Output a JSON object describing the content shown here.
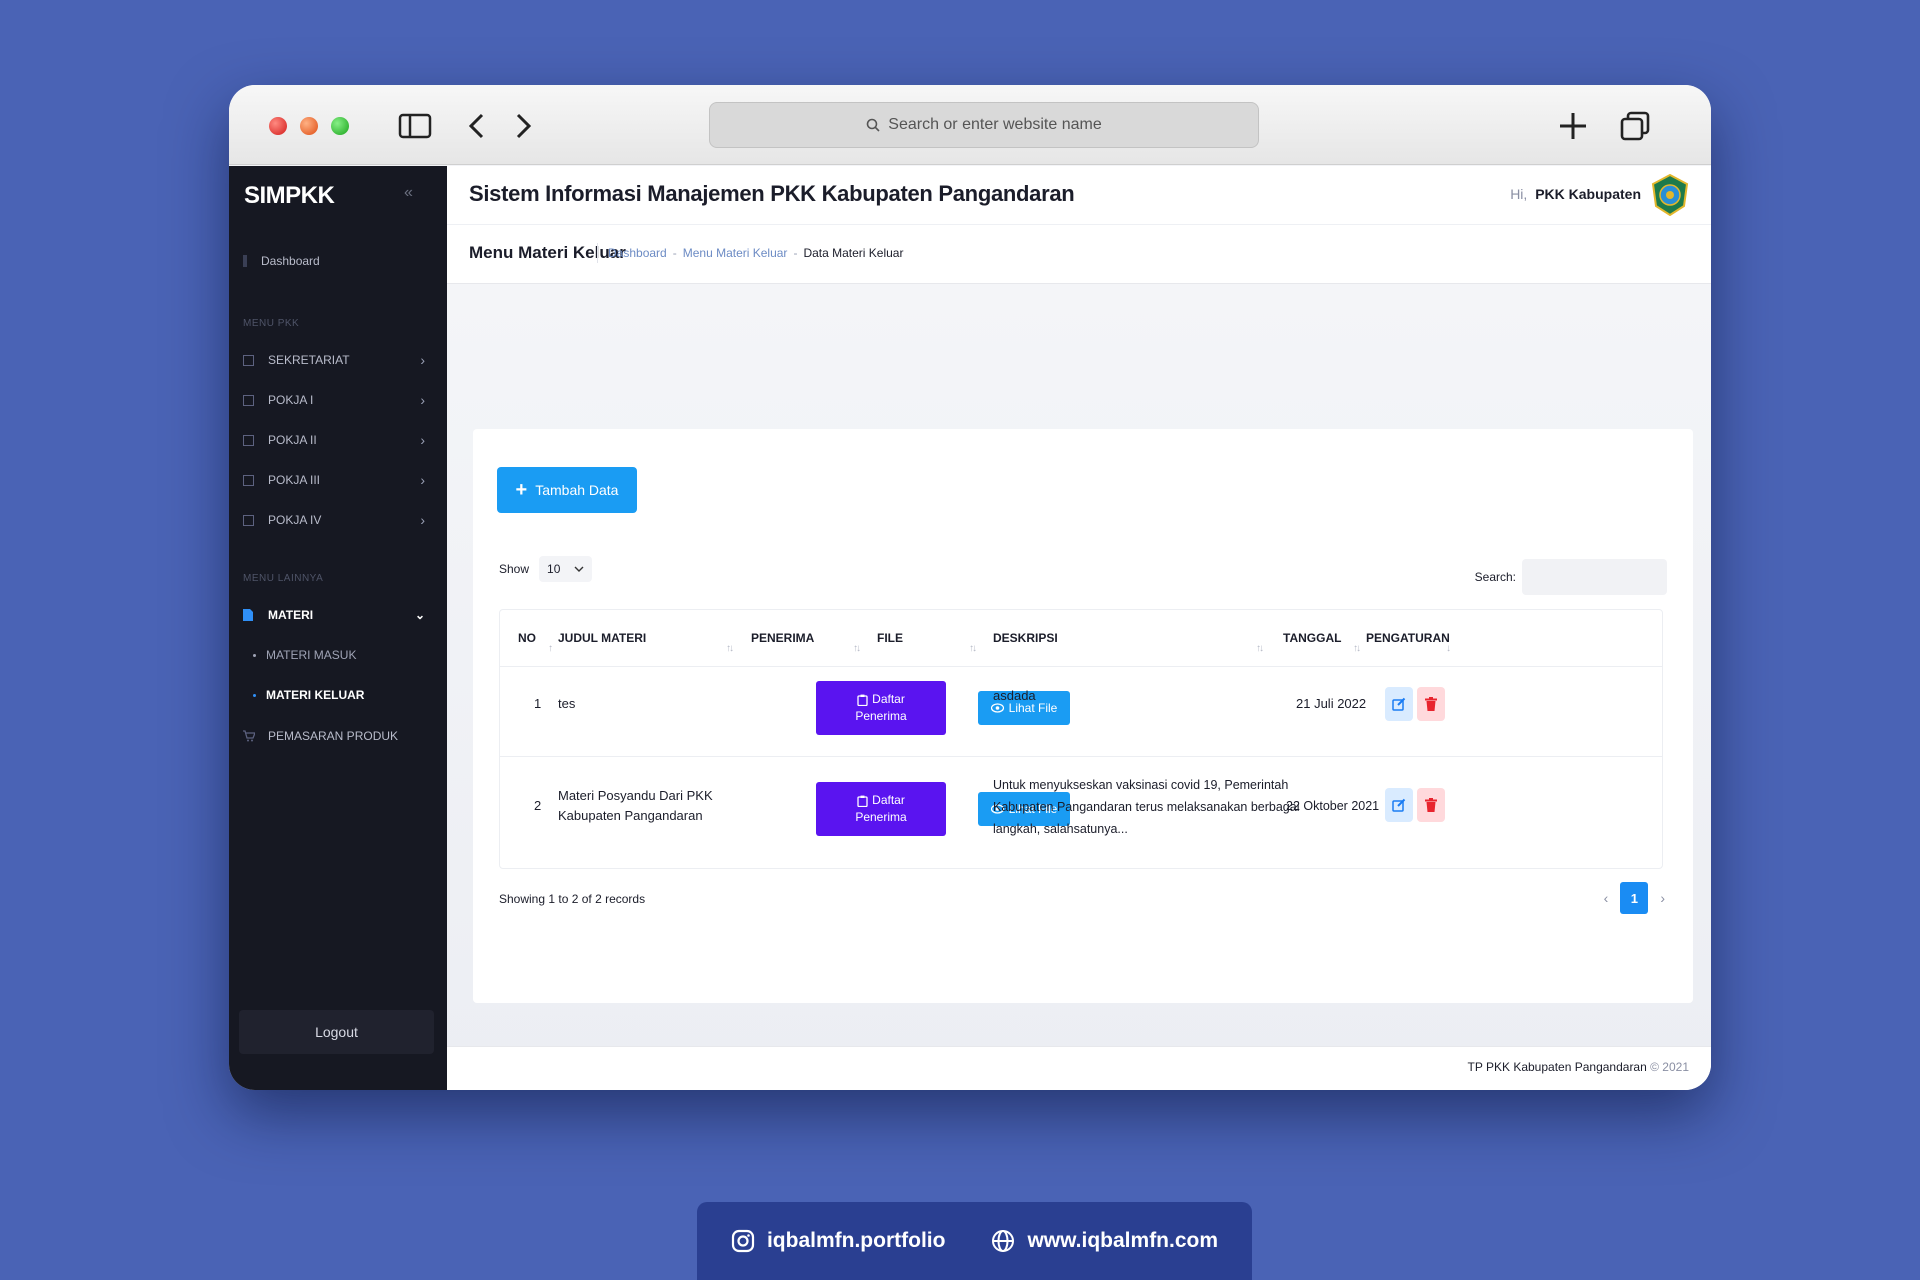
{
  "browser": {
    "url_placeholder": "Search or enter website name"
  },
  "sidebar": {
    "brand": "SIMPKK",
    "dashboard": "Dashboard",
    "menu_pkk_heading": "MENU PKK",
    "menu_pkk": [
      {
        "label": "SEKRETARIAT"
      },
      {
        "label": "POKJA I"
      },
      {
        "label": "POKJA II"
      },
      {
        "label": "POKJA III"
      },
      {
        "label": "POKJA IV"
      }
    ],
    "menu_lainnya_heading": "MENU LAINNYA",
    "materi": "MATERI",
    "materi_sub": [
      {
        "label": "MATERI MASUK"
      },
      {
        "label": "MATERI KELUAR"
      }
    ],
    "pemasaran": "PEMASARAN PRODUK",
    "logout": "Logout"
  },
  "header": {
    "app_title": "Sistem Informasi Manajemen PKK Kabupaten Pangandaran",
    "greeting_hi": "Hi,",
    "greeting_name": "PKK Kabupaten",
    "page_title": "Menu Materi Keluar",
    "breadcrumb": [
      "Dashboard",
      "Menu Materi Keluar",
      "Data Materi Keluar"
    ],
    "breadcrumb_sep": "-"
  },
  "content": {
    "add_button": "Tambah Data",
    "show_label": "Show",
    "show_value": "10",
    "search_label": "Search:",
    "columns": [
      "NO",
      "JUDUL MATERI",
      "PENERIMA",
      "FILE",
      "DESKRIPSI",
      "TANGGAL",
      "PENGATURAN"
    ],
    "rows": [
      {
        "no": "1",
        "judul": "tes",
        "penerima_btn_line1": "Daftar",
        "penerima_btn_line2": "Penerima",
        "file_btn": "Lihat File",
        "deskripsi": "asdada",
        "tanggal": "21 Juli 2022"
      },
      {
        "no": "2",
        "judul": "Materi Posyandu Dari PKK Kabupaten Pangandaran",
        "penerima_btn_line1": "Daftar",
        "penerima_btn_line2": "Penerima",
        "file_btn": "Lihat File",
        "deskripsi": "Untuk menyukseskan vaksinasi covid 19, Pemerintah Kabupaten Pangandaran terus melaksanakan berbagai langkah, salahsatunya...",
        "tanggal": "22 Oktober 2021"
      }
    ],
    "records_info": "Showing 1 to 2 of 2 records",
    "current_page": "1"
  },
  "footer": {
    "text": "TP PKK Kabupaten Pangandaran",
    "copyright": "© 2021"
  },
  "social": {
    "instagram": "iqbalmfn.portfolio",
    "website": "www.iqbalmfn.com"
  },
  "colors": {
    "background": "#4a63b5",
    "sidebar": "#161822",
    "primary": "#1a9cf3",
    "purple": "#5a14f0",
    "danger": "#e8242e"
  }
}
